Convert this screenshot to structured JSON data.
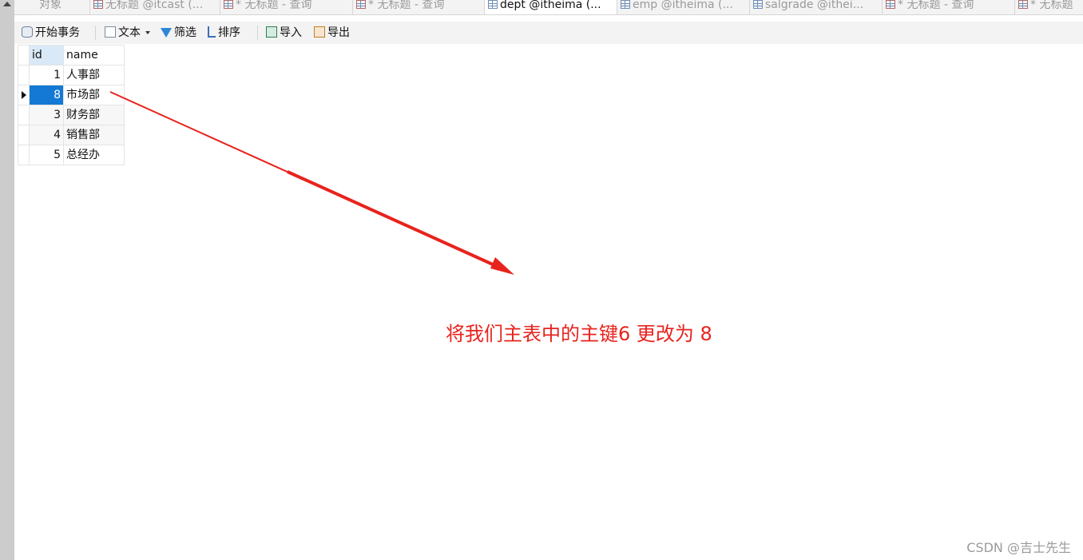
{
  "tabs": [
    {
      "label": "对象",
      "icon": "none",
      "active": false
    },
    {
      "label": "无标题 @itcast (...",
      "icon": "query-icon",
      "active": false
    },
    {
      "label": "* 无标题 - 查询",
      "icon": "query-icon",
      "active": false
    },
    {
      "label": "* 无标题 - 查询",
      "icon": "query-icon",
      "active": false
    },
    {
      "label": "dept @itheima (...",
      "icon": "table-icon",
      "active": true
    },
    {
      "label": "emp @itheima (...",
      "icon": "table-icon",
      "active": false
    },
    {
      "label": "salgrade @ithei...",
      "icon": "table-icon",
      "active": false
    },
    {
      "label": "* 无标题 - 查询",
      "icon": "query-icon",
      "active": false
    },
    {
      "label": "* 无标题",
      "icon": "query-icon",
      "active": false
    }
  ],
  "toolbar": {
    "begin_transaction": "开始事务",
    "text": "文本",
    "filter": "筛选",
    "sort": "排序",
    "import": "导入",
    "export": "导出"
  },
  "grid": {
    "columns": [
      "id",
      "name"
    ],
    "rows": [
      {
        "id": "1",
        "name": "人事部"
      },
      {
        "id": "8",
        "name": "市场部"
      },
      {
        "id": "3",
        "name": "财务部"
      },
      {
        "id": "4",
        "name": "销售部"
      },
      {
        "id": "5",
        "name": "总经办"
      }
    ],
    "selected_row_index": 1
  },
  "annotation": {
    "text": "将我们主表中的主键6 更改为 8",
    "color": "#e8231d"
  },
  "watermark": "CSDN @吉士先生"
}
